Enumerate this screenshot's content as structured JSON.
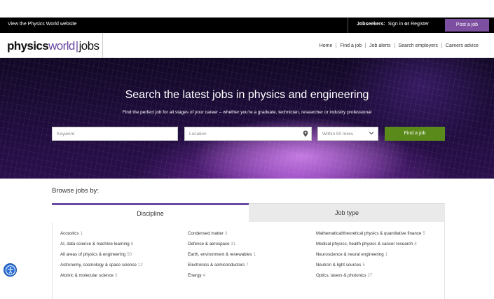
{
  "topbar": {
    "site_link": "View the Physics World website",
    "jobseekers_label": "Jobseekers:",
    "sign_in": "Sign in",
    "or": "or",
    "register": "Register",
    "post_job": "Post a job"
  },
  "logo": {
    "part1": "physics",
    "part2": "world",
    "bar": "|",
    "part3": "jobs"
  },
  "nav": [
    {
      "label": "Home"
    },
    {
      "label": "Find a job"
    },
    {
      "label": "Job alerts"
    },
    {
      "label": "Search employers"
    },
    {
      "label": "Careers advice"
    }
  ],
  "hero": {
    "title": "Search the latest jobs in physics and engineering",
    "subtitle": "Find the perfect job for all stages of your career – whether you're a graduate, technician, researcher or industry professional"
  },
  "search": {
    "keyword_placeholder": "Keyword",
    "location_placeholder": "Location",
    "distance_value": "Within 50 miles",
    "button": "Find a job"
  },
  "browse": {
    "title": "Browse jobs by:",
    "tabs": [
      {
        "label": "Discipline",
        "active": true
      },
      {
        "label": "Job type",
        "active": false
      }
    ],
    "columns": [
      [
        {
          "label": "Acoustics",
          "count": "1"
        },
        {
          "label": "AI, data science & machine learning",
          "count": "6"
        },
        {
          "label": "All areas of physics & engineering",
          "count": "50"
        },
        {
          "label": "Astronomy, cosmology & space science",
          "count": "12"
        },
        {
          "label": "Atomic & molecular science",
          "count": "3"
        }
      ],
      [
        {
          "label": "Condensed matter",
          "count": "3"
        },
        {
          "label": "Defence & aerospace",
          "count": "31"
        },
        {
          "label": "Earth, environment & renewables",
          "count": "1"
        },
        {
          "label": "Electronics & semiconductors",
          "count": "7"
        },
        {
          "label": "Energy",
          "count": "4"
        }
      ],
      [
        {
          "label": "Mathematical/theoretical physics & quantitative finance",
          "count": "5"
        },
        {
          "label": "Medical physics, health physics & cancer research",
          "count": "8"
        },
        {
          "label": "Neuroscience & neural engineering",
          "count": "1"
        },
        {
          "label": "Neutron & light sources",
          "count": "5"
        },
        {
          "label": "Optics, lasers & photonics",
          "count": "27"
        }
      ]
    ]
  },
  "colors": {
    "accent_purple": "#7d4fa0",
    "find_button_green": "#5a8a1a",
    "topbar_black": "#000000"
  }
}
